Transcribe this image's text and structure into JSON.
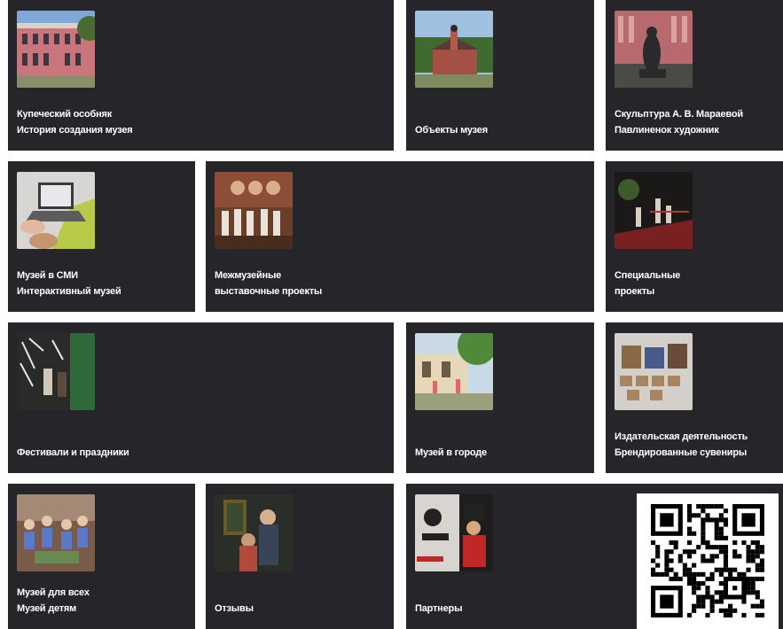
{
  "tiles": [
    {
      "id": "osobnyak",
      "lines": [
        "Купеческий особняк",
        "История создания музея"
      ],
      "image": "pink-mansion-photo"
    },
    {
      "id": "objects",
      "lines": [
        "Объекты музея"
      ],
      "image": "church-photo"
    },
    {
      "id": "sculpture",
      "lines": [
        "Скульптура А. В. Мараевой",
        "Павлиненок художник"
      ],
      "image": "sculpture-photo"
    },
    {
      "id": "smi",
      "lines": [
        "Музей в СМИ",
        "Интерактивный музей"
      ],
      "image": "laptop-photo"
    },
    {
      "id": "mezhmuz",
      "lines": [
        "Межмузейные",
        "выставочные проекты"
      ],
      "image": "group-photo"
    },
    {
      "id": "special",
      "lines": [
        "Специальные",
        "проекты"
      ],
      "image": "night-event-photo"
    },
    {
      "id": "festivals",
      "lines": [
        "Фестивали и праздники"
      ],
      "image": "festival-photo"
    },
    {
      "id": "city",
      "lines": [
        "Музей в городе"
      ],
      "image": "street-photo"
    },
    {
      "id": "publishing",
      "lines": [
        "Издательская деятельность",
        "Брендированные сувениры"
      ],
      "image": "souvenirs-photo"
    },
    {
      "id": "forall",
      "lines": [
        "Музей для всех",
        "Музей детям"
      ],
      "image": "children-photo"
    },
    {
      "id": "reviews",
      "lines": [
        "Отзывы"
      ],
      "image": "visitors-photo"
    },
    {
      "id": "partners",
      "lines": [
        "Партнеры"
      ],
      "image": "partners-photo"
    }
  ],
  "qr": {
    "icon": "qr-code-icon"
  }
}
